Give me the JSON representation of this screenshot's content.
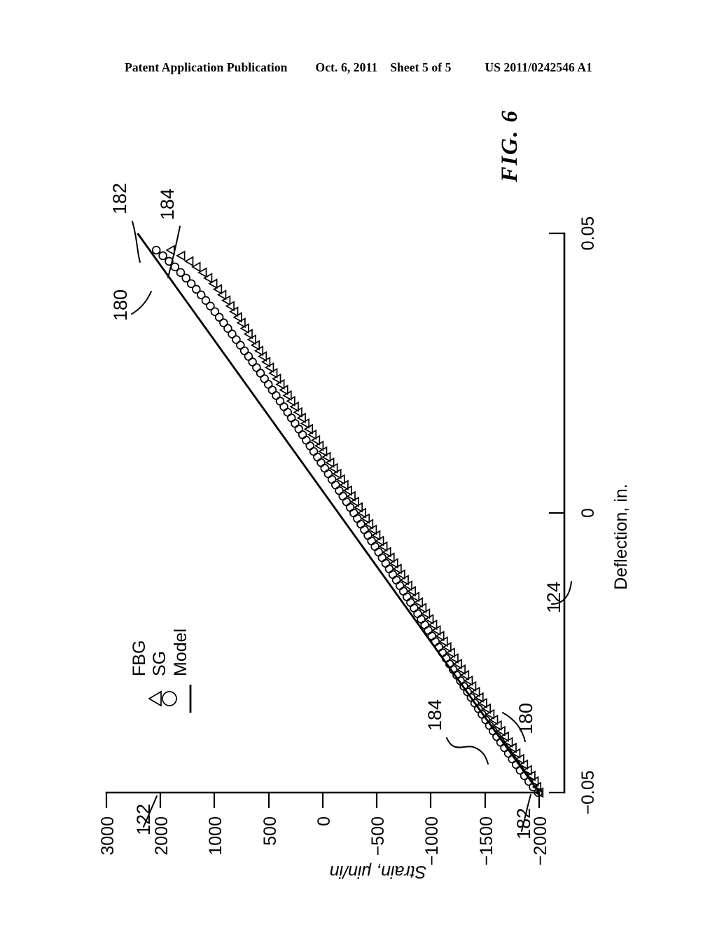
{
  "header": {
    "publication": "Patent Application Publication",
    "date": "Oct. 6, 2011",
    "sheet": "Sheet 5 of 5",
    "number": "US 2011/0242546 A1"
  },
  "figure": {
    "caption": "FIG. 6"
  },
  "reference_numerals": {
    "model_line_top": "180",
    "model_line_bottom": "180",
    "sg_points_top": "182",
    "sg_points_bottom": "182",
    "fbg_points_top": "184",
    "fbg_points_bottom": "184",
    "y_axis": "122",
    "x_axis": "124"
  },
  "chart_data": {
    "type": "scatter",
    "title": "FIG. 6",
    "xlabel": "Deflection, in.",
    "ylabel": "Strain, μin/in",
    "xlim": [
      -0.05,
      0.05
    ],
    "ylim": [
      -2000,
      3000
    ],
    "xticks": [
      -0.05,
      0,
      0.05
    ],
    "xtick_labels": [
      "−0.05",
      "0",
      "0.05"
    ],
    "ytick_labels": [
      "3000",
      "2000",
      "1000",
      "500",
      "0",
      "−500",
      "−1000",
      "−1500",
      "−2000"
    ],
    "ytick_values": [
      3000,
      2000,
      1000,
      500,
      0,
      -500,
      -1000,
      -1500,
      -2000
    ],
    "grid": false,
    "legend_position": "upper-left",
    "legend": [
      {
        "marker": "triangle",
        "label": "FBG"
      },
      {
        "marker": "circle",
        "label": "SG"
      },
      {
        "marker": "line",
        "label": "Model"
      }
    ],
    "series": [
      {
        "name": "Model",
        "marker": "line",
        "x": [
          -0.05,
          0.05
        ],
        "y": [
          -2000,
          2640
        ]
      },
      {
        "name": "SG",
        "marker": "circle",
        "x": [
          -0.05,
          -0.049,
          -0.048,
          -0.047,
          -0.046,
          -0.045,
          -0.044,
          -0.043,
          -0.042,
          -0.041,
          -0.04,
          -0.039,
          -0.038,
          -0.037,
          -0.036,
          -0.035,
          -0.034,
          -0.033,
          -0.032,
          -0.031,
          -0.03,
          -0.029,
          -0.028,
          -0.027,
          -0.026,
          -0.025,
          -0.024,
          -0.023,
          -0.022,
          -0.021,
          -0.02,
          -0.019,
          -0.018,
          -0.017,
          -0.016,
          -0.015,
          -0.014,
          -0.013,
          -0.012,
          -0.011,
          -0.01,
          -0.009,
          -0.008,
          -0.007,
          -0.006,
          -0.005,
          -0.004,
          -0.003,
          -0.002,
          -0.001,
          0.0,
          0.001,
          0.002,
          0.003,
          0.004,
          0.005,
          0.006,
          0.007,
          0.008,
          0.009,
          0.01,
          0.011,
          0.012,
          0.013,
          0.014,
          0.015,
          0.016,
          0.017,
          0.018,
          0.019,
          0.02,
          0.021,
          0.022,
          0.023,
          0.024,
          0.025,
          0.026,
          0.027,
          0.028,
          0.029,
          0.03,
          0.031,
          0.032,
          0.033,
          0.034,
          0.035,
          0.036,
          0.037,
          0.038,
          0.039,
          0.04,
          0.041,
          0.042,
          0.043,
          0.044,
          0.045,
          0.046,
          0.047
        ],
        "y": [
          -1990,
          -1930,
          -1880,
          -1830,
          -1780,
          -1735,
          -1690,
          -1645,
          -1600,
          -1555,
          -1510,
          -1468,
          -1425,
          -1382,
          -1340,
          -1298,
          -1256,
          -1214,
          -1172,
          -1130,
          -1090,
          -1048,
          -1006,
          -965,
          -924,
          -883,
          -842,
          -801,
          -760,
          -719,
          -678,
          -637,
          -596,
          -555,
          -514,
          -473,
          -432,
          -391,
          -350,
          -309,
          -268,
          -227,
          -186,
          -145,
          -104,
          -63,
          -22,
          19,
          60,
          101,
          142,
          184,
          226,
          268,
          310,
          352,
          394,
          436,
          478,
          520,
          562,
          605,
          648,
          691,
          734,
          777,
          820,
          863,
          906,
          949,
          994,
          1039,
          1084,
          1129,
          1174,
          1220,
          1266,
          1312,
          1358,
          1405,
          1452,
          1500,
          1548,
          1597,
          1646,
          1696,
          1747,
          1799,
          1852,
          1906,
          1962,
          2020,
          2080,
          2143,
          2208,
          2276,
          2348,
          2424
        ]
      },
      {
        "name": "FBG",
        "marker": "triangle",
        "x": [
          -0.05,
          -0.049,
          -0.048,
          -0.047,
          -0.046,
          -0.045,
          -0.044,
          -0.043,
          -0.042,
          -0.041,
          -0.04,
          -0.039,
          -0.038,
          -0.037,
          -0.036,
          -0.035,
          -0.034,
          -0.033,
          -0.032,
          -0.031,
          -0.03,
          -0.029,
          -0.028,
          -0.027,
          -0.026,
          -0.025,
          -0.024,
          -0.023,
          -0.022,
          -0.021,
          -0.02,
          -0.019,
          -0.018,
          -0.017,
          -0.016,
          -0.015,
          -0.014,
          -0.013,
          -0.012,
          -0.011,
          -0.01,
          -0.009,
          -0.008,
          -0.007,
          -0.006,
          -0.005,
          -0.004,
          -0.003,
          -0.002,
          -0.001,
          0.0,
          0.001,
          0.002,
          0.003,
          0.004,
          0.005,
          0.006,
          0.007,
          0.008,
          0.009,
          0.01,
          0.011,
          0.012,
          0.013,
          0.014,
          0.015,
          0.016,
          0.017,
          0.018,
          0.019,
          0.02,
          0.021,
          0.022,
          0.023,
          0.024,
          0.025,
          0.026,
          0.027,
          0.028,
          0.029,
          0.03,
          0.031,
          0.032,
          0.033,
          0.034,
          0.035,
          0.036,
          0.037,
          0.038,
          0.039,
          0.04,
          0.041,
          0.042,
          0.043,
          0.044,
          0.045,
          0.046,
          0.047
        ],
        "y": [
          -2010,
          -1985,
          -1955,
          -1918,
          -1876,
          -1832,
          -1788,
          -1744,
          -1700,
          -1656,
          -1612,
          -1570,
          -1528,
          -1486,
          -1444,
          -1402,
          -1360,
          -1318,
          -1276,
          -1234,
          -1194,
          -1152,
          -1110,
          -1069,
          -1028,
          -987,
          -946,
          -905,
          -864,
          -823,
          -782,
          -741,
          -700,
          -659,
          -618,
          -577,
          -536,
          -495,
          -454,
          -413,
          -372,
          -331,
          -290,
          -249,
          -208,
          -167,
          -126,
          -85,
          -44,
          -3,
          38,
          79,
          120,
          161,
          202,
          243,
          284,
          325,
          366,
          407,
          448,
          489,
          530,
          571,
          612,
          653,
          694,
          735,
          776,
          817,
          858,
          899,
          940,
          981,
          1022,
          1063,
          1104,
          1145,
          1186,
          1227,
          1268,
          1309,
          1350,
          1391,
          1432,
          1473,
          1516,
          1560,
          1606,
          1654,
          1704,
          1758,
          1816,
          1880,
          1952,
          2034,
          2130,
          2250
        ]
      }
    ]
  }
}
